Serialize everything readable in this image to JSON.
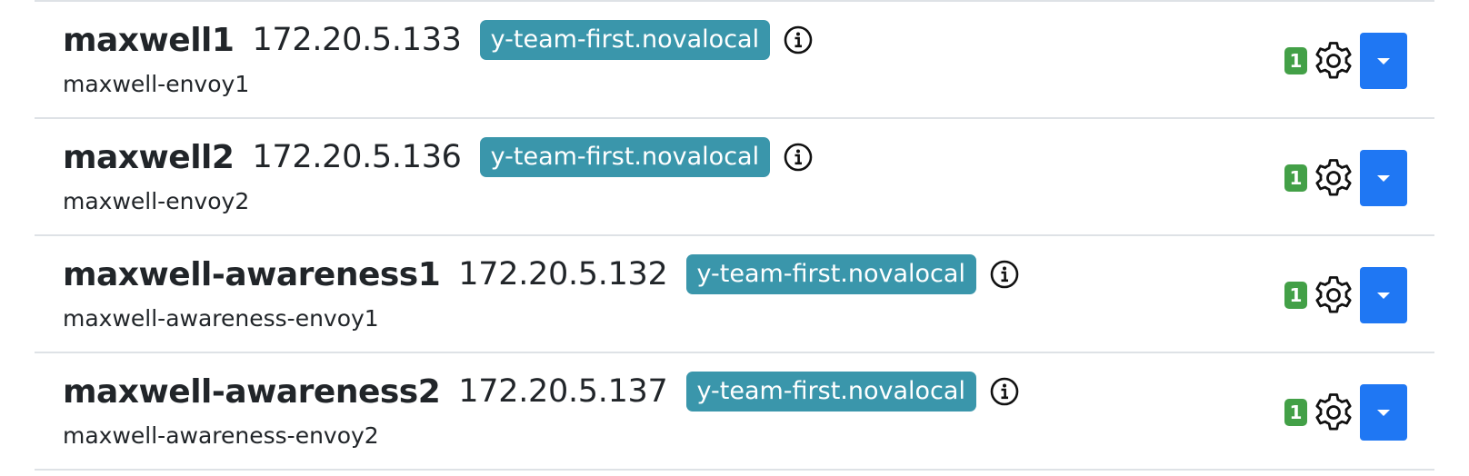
{
  "hosts": [
    {
      "name": "maxwell1",
      "ip": "172.20.5.133",
      "domain": "y-team-first.novalocal",
      "instance": "maxwell-envoy1",
      "count": "1"
    },
    {
      "name": "maxwell2",
      "ip": "172.20.5.136",
      "domain": "y-team-first.novalocal",
      "instance": "maxwell-envoy2",
      "count": "1"
    },
    {
      "name": "maxwell-awareness1",
      "ip": "172.20.5.132",
      "domain": "y-team-first.novalocal",
      "instance": "maxwell-awareness-envoy1",
      "count": "1"
    },
    {
      "name": "maxwell-awareness2",
      "ip": "172.20.5.137",
      "domain": "y-team-first.novalocal",
      "instance": "maxwell-awareness-envoy2",
      "count": "1"
    }
  ],
  "icons": {
    "info": "info-circle-icon",
    "settings": "gear-icon",
    "menu": "caret-down-icon"
  },
  "colors": {
    "domain_badge": "#3a96ab",
    "count_badge": "#43a047",
    "dropdown_button": "#1f77f3",
    "divider": "#dee2e6"
  }
}
